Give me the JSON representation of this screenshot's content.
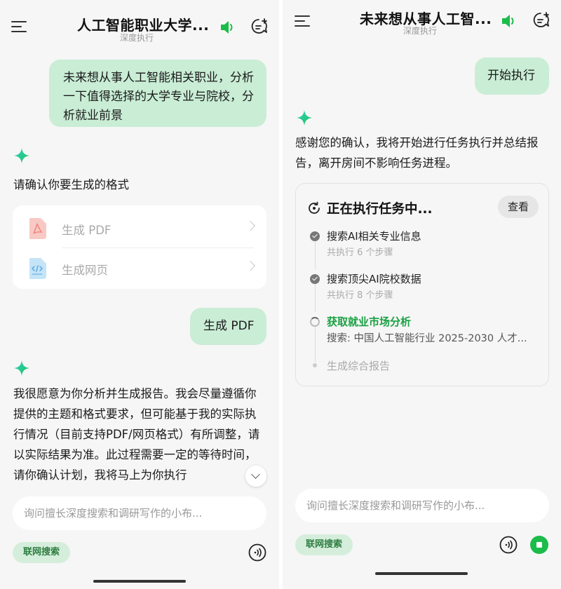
{
  "left": {
    "header": {
      "title": "人工智能职业大学...",
      "subtitle": "深度执行"
    },
    "messages": {
      "user_query": "未来想从事人工智能相关职业，分析一下值得选择的大学专业与院校，分析就业前景",
      "ai_format_prompt": "请确认你要生成的格式",
      "format_options": [
        {
          "label": "生成 PDF",
          "icon": "pdf-file-icon"
        },
        {
          "label": "生成网页",
          "icon": "html-file-icon"
        }
      ],
      "user_choice": "生成 PDF",
      "ai_reply": "我很愿意为你分析并生成报告。我会尽量遵循你提供的主题和格式要求，但可能基于我的实际执行情况（目前支持PDF/网页格式）有所调整，请以实际结果为准。此过程需要一定的等待时间，请你确认计划，我将马上为你执行"
    },
    "composer": {
      "placeholder": "询问擅长深度搜索和调研写作的小布...",
      "web_search_label": "联网搜索"
    }
  },
  "right": {
    "header": {
      "title": "未来想从事人工智...",
      "subtitle": "深度执行"
    },
    "messages": {
      "user_confirm": "开始执行",
      "ai_reply": "感谢您的确认，我将开始进行任务执行并总结报告，离开房间不影响任务进程。"
    },
    "task": {
      "title": "正在执行任务中...",
      "view_label": "查看",
      "steps": [
        {
          "name": "搜索AI相关专业信息",
          "sub": "共执行 6 个步骤",
          "status": "done"
        },
        {
          "name": "搜索顶尖AI院校数据",
          "sub": "共执行 8 个步骤",
          "status": "done"
        },
        {
          "name": "获取就业市场分析",
          "sub": "搜索: 中国人工智能行业 2025-2030 人才...",
          "status": "active"
        },
        {
          "name": "生成综合报告",
          "sub": "",
          "status": "pending"
        }
      ]
    },
    "composer": {
      "placeholder": "询问擅长深度搜索和调研写作的小布...",
      "web_search_label": "联网搜索"
    }
  },
  "colors": {
    "accent_green": "#1cbc4a",
    "user_bubble": "#c9edd5",
    "chip_bg": "#d5eedc",
    "active_step": "#1aa043"
  }
}
